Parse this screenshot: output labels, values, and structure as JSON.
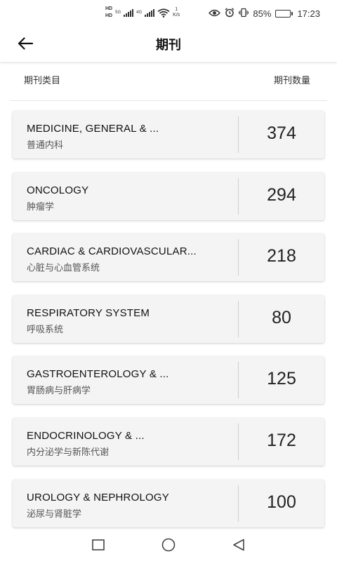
{
  "status_bar": {
    "hd_top": "HD",
    "hd_bottom": "HD",
    "net_type_1": "5G",
    "net_type_2": "4G",
    "speed_value": "1",
    "speed_unit": "K/s",
    "battery_percent": "85%",
    "battery_level": 0.85,
    "time": "17:23"
  },
  "app_bar": {
    "title": "期刊"
  },
  "list_header": {
    "category_label": "期刊类目",
    "count_label": "期刊数量"
  },
  "journals": [
    {
      "title": "MEDICINE, GENERAL & ...",
      "subtitle": "普通内科",
      "count": "374"
    },
    {
      "title": "ONCOLOGY",
      "subtitle": "肿瘤学",
      "count": "294"
    },
    {
      "title": "CARDIAC & CARDIOVASCULAR...",
      "subtitle": "心脏与心血管系统",
      "count": "218"
    },
    {
      "title": "RESPIRATORY SYSTEM",
      "subtitle": "呼吸系统",
      "count": "80"
    },
    {
      "title": "GASTROENTEROLOGY & ...",
      "subtitle": "胃肠病与肝病学",
      "count": "125"
    },
    {
      "title": "ENDOCRINOLOGY & ...",
      "subtitle": "内分泌学与新陈代谢",
      "count": "172"
    },
    {
      "title": "UROLOGY & NEPHROLOGY",
      "subtitle": "泌尿与肾脏学",
      "count": "100"
    }
  ],
  "icons": {
    "back": "arrow-left-icon",
    "nav_recent": "square-icon",
    "nav_home": "circle-icon",
    "nav_back": "triangle-left-icon"
  }
}
